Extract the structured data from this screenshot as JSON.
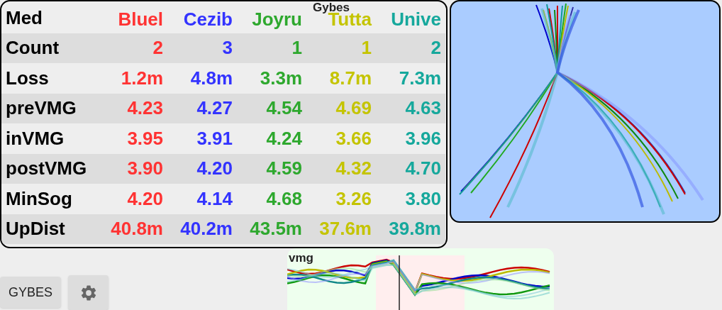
{
  "title": "Gybes",
  "table": {
    "header_label": "Med",
    "columns": [
      {
        "name": "Bluel",
        "color": "#ff3333"
      },
      {
        "name": "Cezib",
        "color": "#3333ff"
      },
      {
        "name": "Joyru",
        "color": "#2ea82e"
      },
      {
        "name": "Tutta",
        "color": "#c4c400"
      },
      {
        "name": "Unive",
        "color": "#16a89c"
      }
    ],
    "rows": [
      {
        "label": "Count",
        "values": [
          "2",
          "3",
          "1",
          "1",
          "2"
        ]
      },
      {
        "label": "Loss",
        "values": [
          "1.2m",
          "4.8m",
          "3.3m",
          "8.7m",
          "7.3m"
        ]
      },
      {
        "label": "preVMG",
        "values": [
          "4.23",
          "4.27",
          "4.54",
          "4.69",
          "4.63"
        ]
      },
      {
        "label": "inVMG",
        "values": [
          "3.95",
          "3.91",
          "4.24",
          "3.66",
          "3.96"
        ]
      },
      {
        "label": "postVMG",
        "values": [
          "3.90",
          "4.20",
          "4.59",
          "4.32",
          "4.70"
        ]
      },
      {
        "label": "MinSog",
        "values": [
          "4.20",
          "4.14",
          "4.68",
          "3.26",
          "3.80"
        ]
      },
      {
        "label": "UpDist",
        "values": [
          "40.8m",
          "40.2m",
          "43.5m",
          "37.6m",
          "39.8m"
        ]
      }
    ]
  },
  "vmg_chart": {
    "label": "vmg"
  },
  "buttons": [
    {
      "kind": "text",
      "label": "GYBES"
    },
    {
      "kind": "icon"
    }
  ]
}
